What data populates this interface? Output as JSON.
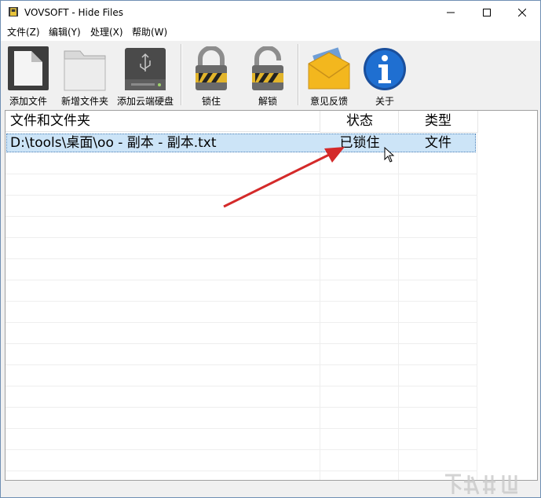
{
  "window": {
    "title": "VOVSOFT - Hide Files"
  },
  "menu": {
    "file": "文件(Z)",
    "edit": "编辑(Y)",
    "process": "处理(X)",
    "help": "帮助(W)"
  },
  "toolbar": {
    "add_file": "添加文件",
    "new_folder": "新增文件夹",
    "add_cloud": "添加云端硬盘",
    "lock": "锁住",
    "unlock": "解锁",
    "feedback": "意见反馈",
    "about": "关于"
  },
  "table": {
    "columns": {
      "name": "文件和文件夹",
      "status": "状态",
      "type": "类型"
    },
    "rows": [
      {
        "name": "D:\\tools\\桌面\\oo - 副本 - 副本.txt",
        "status": "已锁住",
        "type": "文件"
      }
    ]
  },
  "colors": {
    "selection": "#cce4f7",
    "annotation_arrow": "#d42a2a",
    "info_blue": "#1f6fd1",
    "envelope": "#f3b71e"
  },
  "icons": [
    "app-lock-icon",
    "minimize-icon",
    "maximize-icon",
    "close-icon",
    "file-icon",
    "folder-icon",
    "drive-icon",
    "padlock-closed-icon",
    "padlock-open-icon",
    "envelope-icon",
    "info-icon",
    "mouse-cursor-icon"
  ]
}
